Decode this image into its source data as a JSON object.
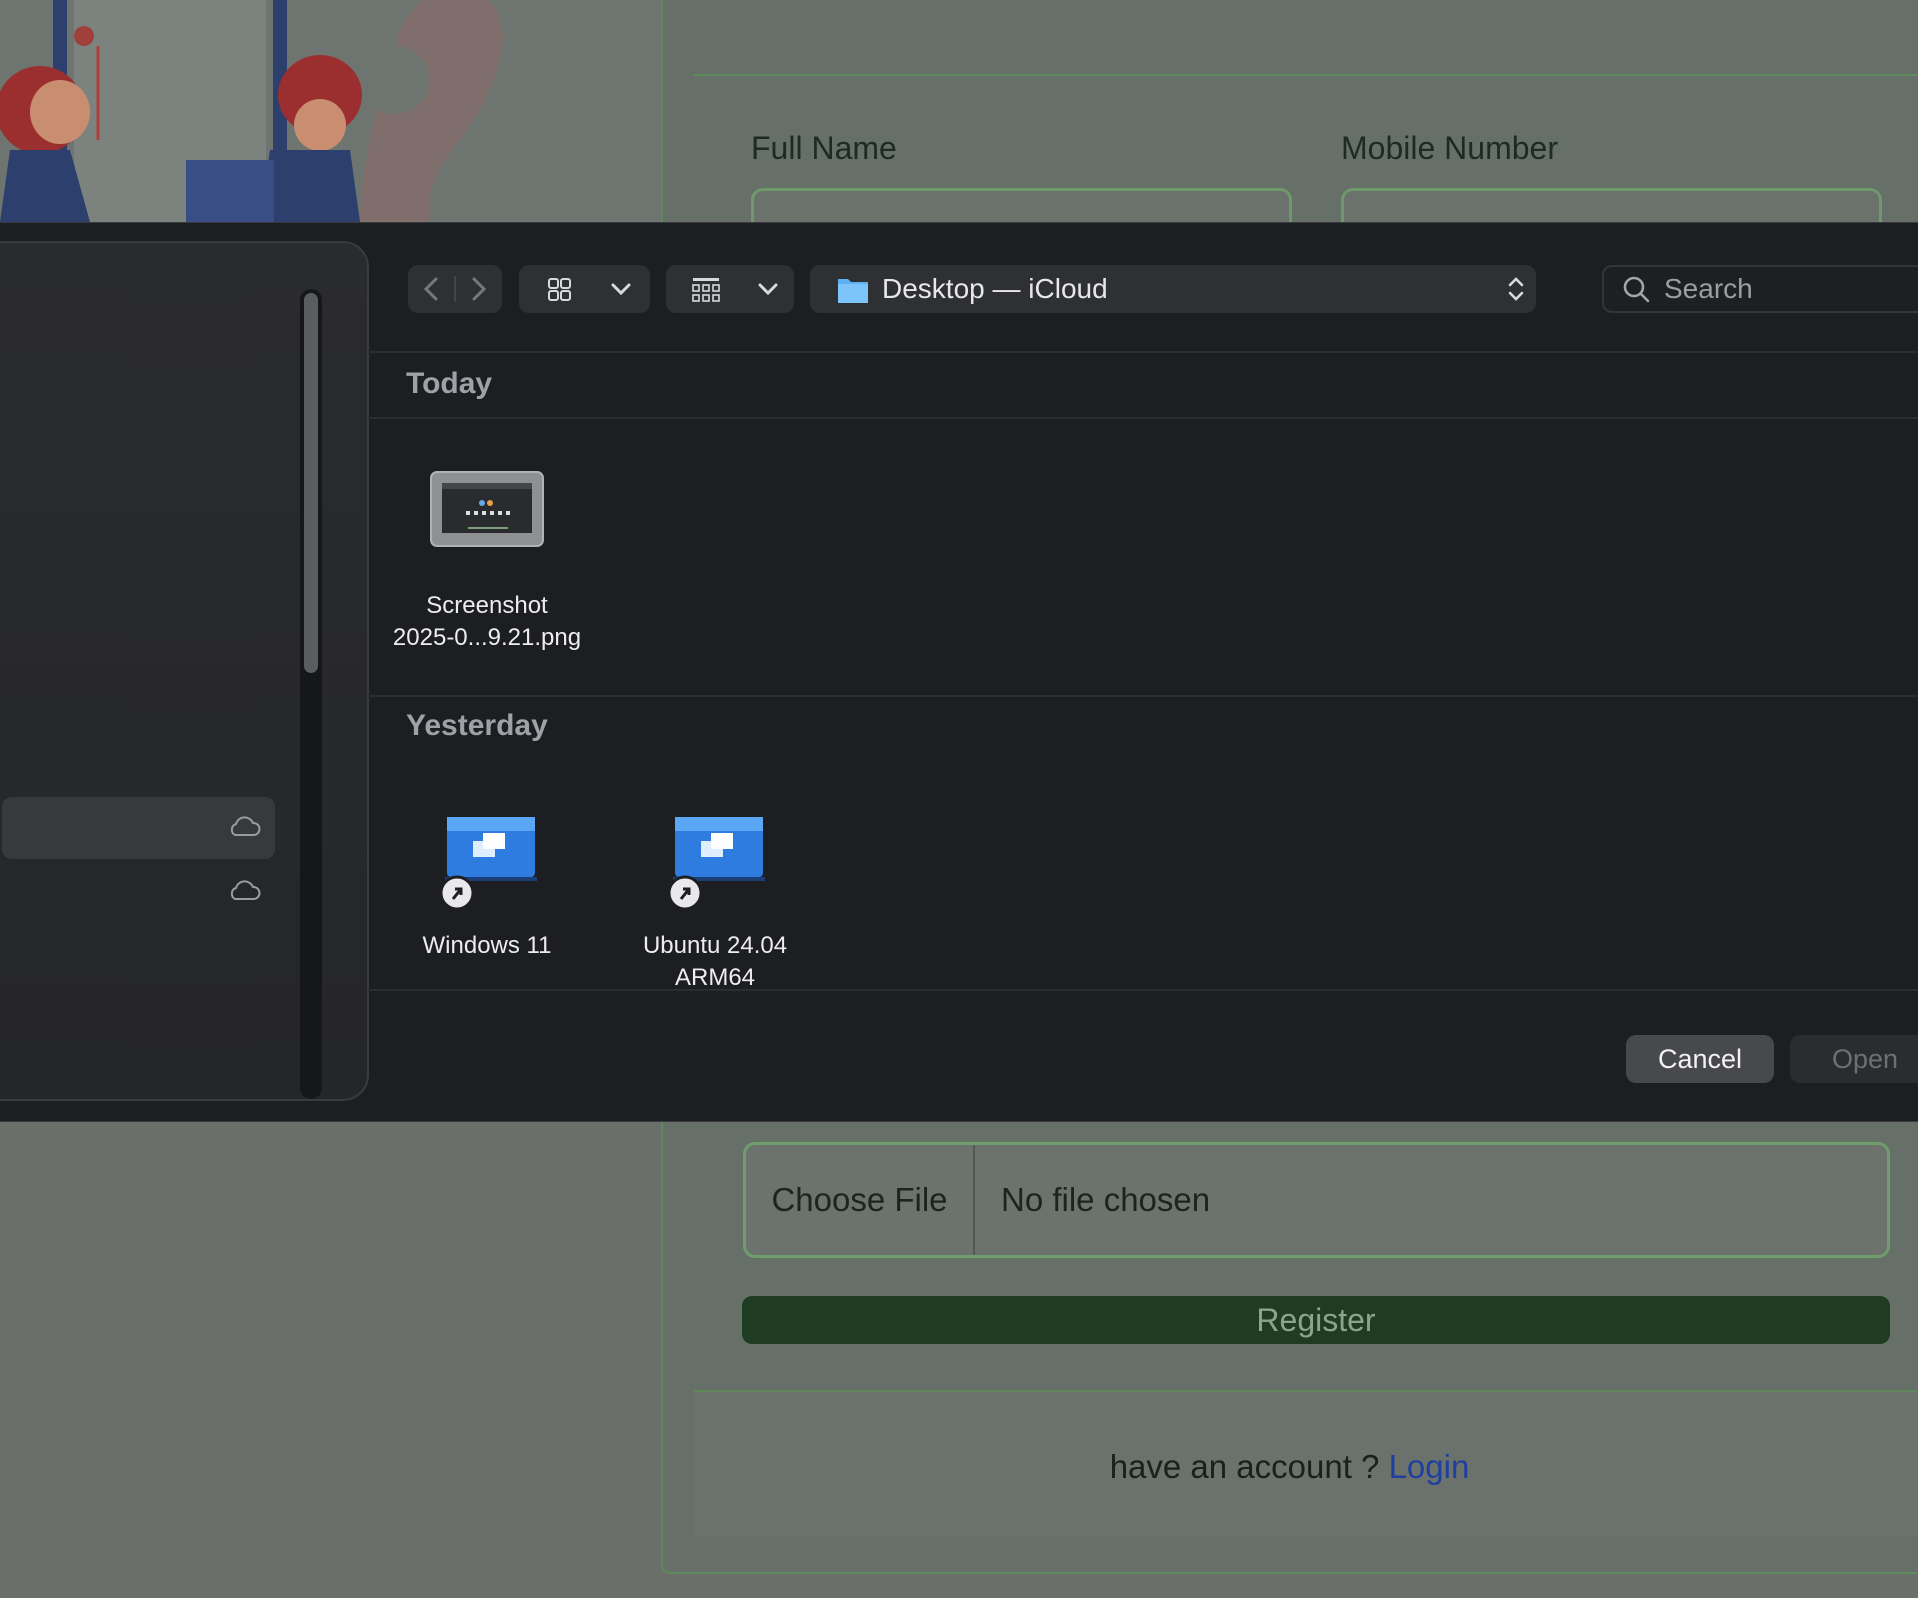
{
  "form": {
    "full_name_label": "Full Name",
    "mobile_label": "Mobile Number",
    "choose_file_label": "Choose File",
    "no_file_text": "No file chosen",
    "register_label": "Register",
    "login_prompt": "have an account ? ",
    "login_link": "Login"
  },
  "dialog": {
    "location": "Desktop — iCloud",
    "search_placeholder": "Search",
    "sections": [
      {
        "title": "Today",
        "files": [
          {
            "name_line1": "Screenshot",
            "name_line2": "2025-0...9.21.png",
            "icon": "screenshot-thumbnail-icon"
          }
        ]
      },
      {
        "title": "Yesterday",
        "files": [
          {
            "name_line1": "Windows 11",
            "name_line2": "",
            "icon": "vm-alias-icon"
          },
          {
            "name_line1": "Ubuntu 24.04",
            "name_line2": "ARM64",
            "icon": "vm-alias-icon"
          }
        ]
      }
    ],
    "cancel_label": "Cancel",
    "open_label": "Open"
  },
  "colors": {
    "dialog_bg": "#1d1e21",
    "register_bg": "#1f3c22",
    "link": "#1e3fa0",
    "folder_blue": "#5ab2f5"
  }
}
